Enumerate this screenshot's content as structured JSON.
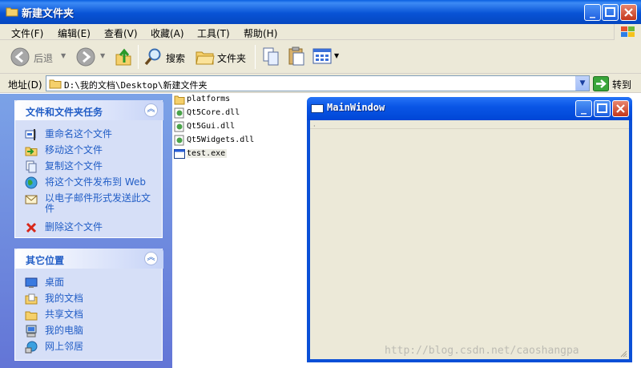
{
  "window": {
    "title": "新建文件夹"
  },
  "menu": [
    "文件(F)",
    "编辑(E)",
    "查看(V)",
    "收藏(A)",
    "工具(T)",
    "帮助(H)"
  ],
  "toolbar": {
    "back_label": "后退",
    "search_label": "搜索",
    "folders_label": "文件夹"
  },
  "address": {
    "label": "地址(D)",
    "value": "D:\\我的文档\\Desktop\\新建文件夹",
    "go_label": "转到"
  },
  "tasks_panel": {
    "title": "文件和文件夹任务",
    "items": [
      "重命名这个文件",
      "移动这个文件",
      "复制这个文件",
      "将这个文件发布到 Web",
      "以电子邮件形式发送此文件",
      "删除这个文件"
    ]
  },
  "places_panel": {
    "title": "其它位置",
    "items": [
      "桌面",
      "我的文档",
      "共享文档",
      "我的电脑",
      "网上邻居"
    ]
  },
  "files": [
    "platforms",
    "Qt5Core.dll",
    "Qt5Gui.dll",
    "Qt5Widgets.dll",
    "test.exe"
  ],
  "mainwindow": {
    "title": "MainWindow"
  },
  "watermark": "http://blog.csdn.net/caoshangpa",
  "colors": {
    "title_blue": "#0853d6",
    "panel_text": "#215dc6",
    "pane_bg": "#7ba2e7",
    "chrome": "#ece9d8"
  }
}
